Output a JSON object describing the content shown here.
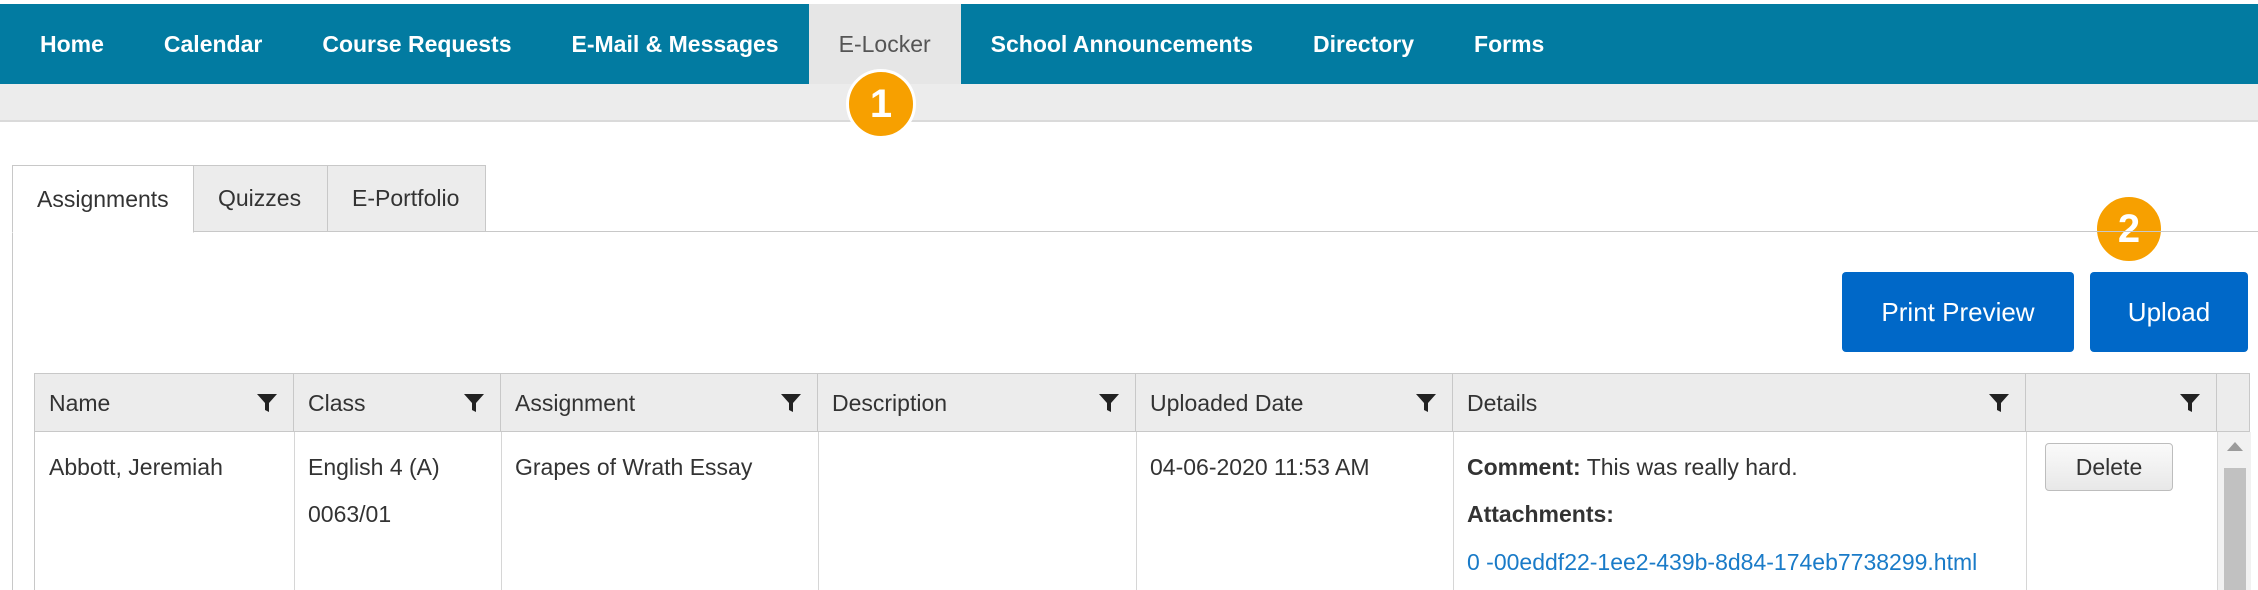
{
  "nav": {
    "items": [
      {
        "label": "Home"
      },
      {
        "label": "Calendar"
      },
      {
        "label": "Course Requests"
      },
      {
        "label": "E-Mail & Messages"
      },
      {
        "label": "E-Locker",
        "active": true
      },
      {
        "label": "School Announcements"
      },
      {
        "label": "Directory"
      },
      {
        "label": "Forms"
      }
    ]
  },
  "markers": {
    "one": "1",
    "two": "2"
  },
  "tabs": [
    {
      "label": "Assignments",
      "active": true
    },
    {
      "label": "Quizzes"
    },
    {
      "label": "E-Portfolio"
    }
  ],
  "toolbar": {
    "print_preview": "Print Preview",
    "upload": "Upload"
  },
  "table": {
    "columns": [
      "Name",
      "Class",
      "Assignment",
      "Description",
      "Uploaded Date",
      "Details",
      ""
    ],
    "rows": [
      {
        "name": "Abbott, Jeremiah",
        "class_name": "English 4 (A)",
        "class_code": "0063/01",
        "assignment": "Grapes of Wrath Essay",
        "description": "",
        "uploaded_date": "04-06-2020 11:53 AM",
        "comment_label": "Comment:",
        "comment": "This was really hard.",
        "attachments_label": "Attachments:",
        "attachment": "0 -00eddf22-1ee2-439b-8d84-174eb7738299.html",
        "delete_label": "Delete"
      }
    ]
  },
  "colors": {
    "nav_bg": "#027ba1",
    "marker": "#f7a000",
    "button": "#0068c8",
    "link": "#1a7bc8"
  }
}
